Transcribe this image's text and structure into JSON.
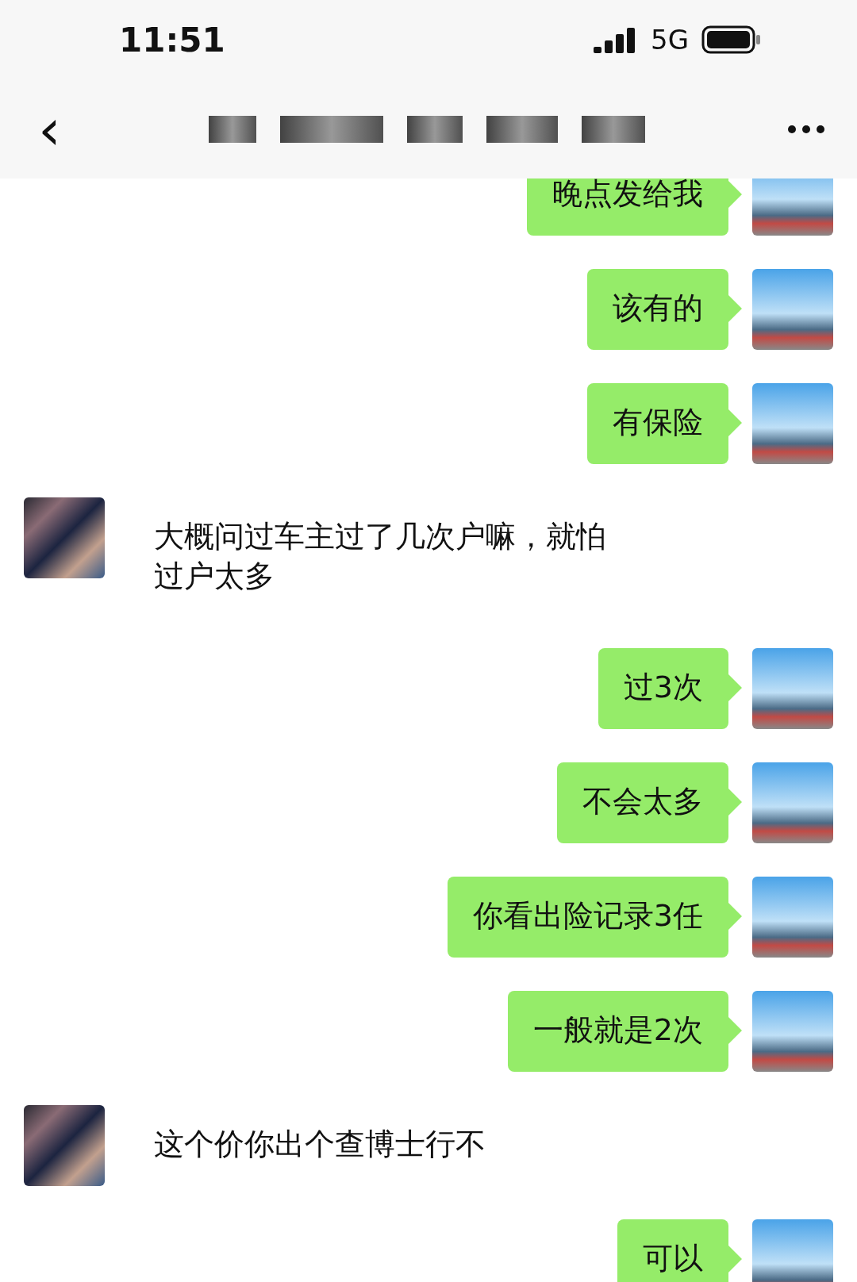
{
  "status_bar": {
    "time": "11:51",
    "network": "5G"
  },
  "header": {
    "back": "‹"
  },
  "messages": [
    {
      "kind": "sent",
      "text": "晚点发给我"
    },
    {
      "kind": "sent",
      "text": "该有的"
    },
    {
      "kind": "sent",
      "text": "有保险"
    },
    {
      "kind": "received",
      "text": "大概问过车主过了几次户嘛，就怕过户太多"
    },
    {
      "kind": "sent",
      "text": "过3次"
    },
    {
      "kind": "sent",
      "text": "不会太多"
    },
    {
      "kind": "sent",
      "text": "你看出险记录3任"
    },
    {
      "kind": "sent",
      "text": "一般就是2次"
    },
    {
      "kind": "received",
      "text": "这个价你出个查博士行不"
    },
    {
      "kind": "sent",
      "text": "可以"
    }
  ]
}
